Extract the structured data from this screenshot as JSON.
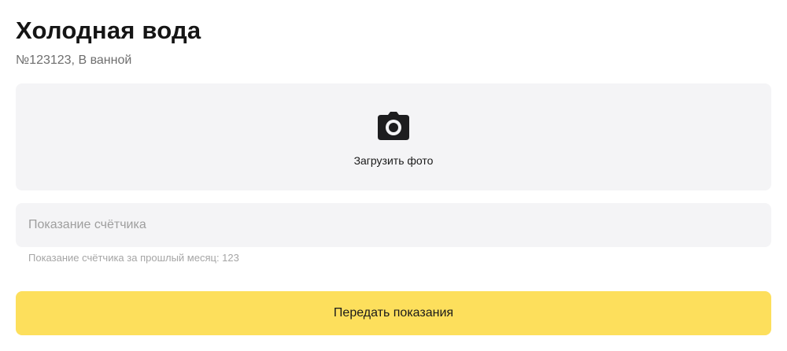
{
  "header": {
    "title": "Холодная вода",
    "subtitle": "№123123, В ванной"
  },
  "upload": {
    "icon": "camera-icon",
    "label": "Загрузить фото"
  },
  "reading": {
    "value": "",
    "placeholder": "Показание счётчика",
    "hint": "Показание счётчика за прошлый месяц: 123"
  },
  "submit": {
    "label": "Передать показания"
  },
  "colors": {
    "accent": "#fddf5c",
    "field_bg": "#f4f4f6"
  }
}
